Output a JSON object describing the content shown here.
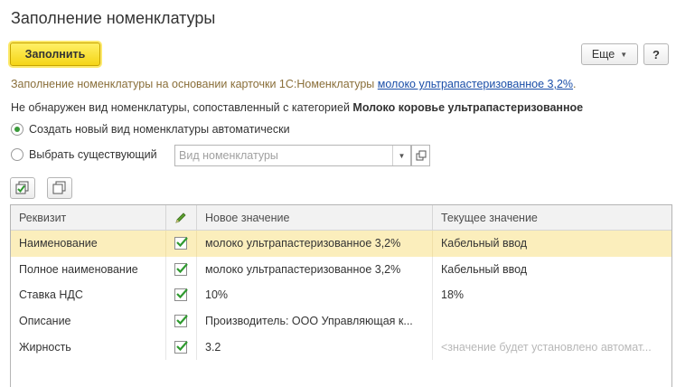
{
  "form": {
    "title": "Заполнение номенклатуры",
    "fill_button": "Заполнить",
    "more_button": "Еще",
    "help_button": "?"
  },
  "info": {
    "prefix": "Заполнение номенклатуры на основании карточки 1С:Номенклатуры ",
    "link": "молоко ультрапастеризованное 3,2%",
    "suffix": "."
  },
  "notice": {
    "text": "Не обнаружен вид номенклатуры, сопоставленный с категорией ",
    "category": "Молоко коровье ультрапастеризованное"
  },
  "options": {
    "create_label": "Создать новый вид номенклатуры автоматически",
    "create_selected": true,
    "choose_label": "Выбрать существующий",
    "choose_selected": false,
    "kind_placeholder": "Вид номенклатуры"
  },
  "table": {
    "headers": {
      "attribute": "Реквизит",
      "new_value": "Новое значение",
      "current_value": "Текущее значение"
    },
    "rows": [
      {
        "attribute": "Наименование",
        "checked": true,
        "new_value": "молоко ультрапастеризованное 3,2%",
        "current_value": "Кабельный ввод",
        "selected": true
      },
      {
        "attribute": "Полное наименование",
        "checked": true,
        "new_value": "молоко ультрапастеризованное 3,2%",
        "current_value": "Кабельный ввод",
        "selected": false
      },
      {
        "attribute": "Ставка НДС",
        "checked": true,
        "new_value": "10%",
        "current_value": "18%",
        "selected": false
      },
      {
        "attribute": "Описание",
        "checked": true,
        "new_value": "Производитель: ООО Управляющая к...",
        "current_value": "",
        "selected": false
      },
      {
        "attribute": "Жирность",
        "checked": true,
        "new_value": "3.2",
        "current_value": "<значение будет установлено автомат...",
        "selected": false
      }
    ]
  },
  "colors": {
    "accent_button": "#f5d516",
    "selected_row": "#fbeebc",
    "check": "#2f9a2f",
    "link": "#1a4ea8"
  }
}
